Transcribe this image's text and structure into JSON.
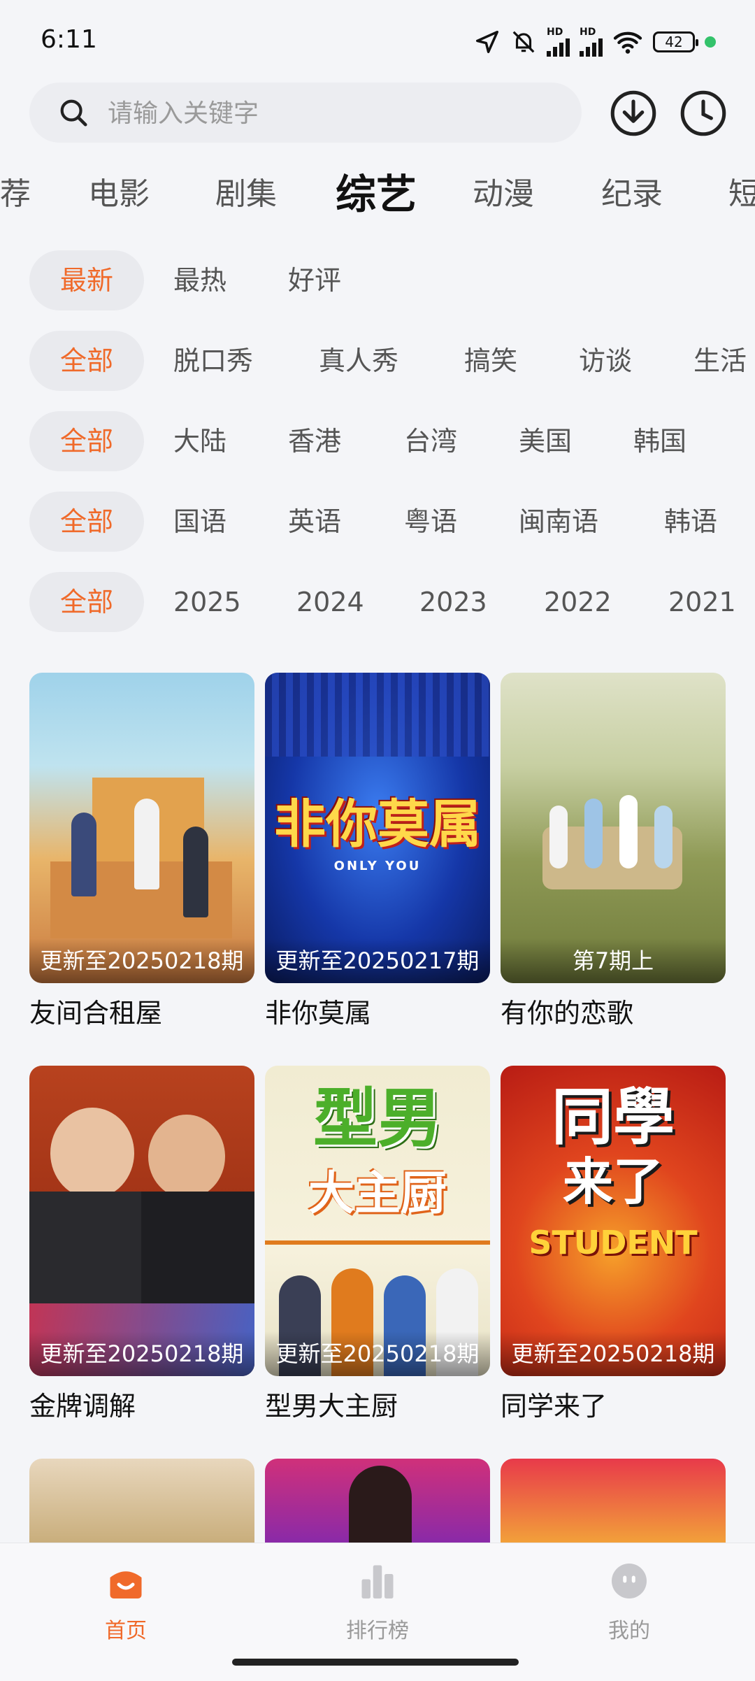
{
  "status_bar": {
    "time": "6:11",
    "battery": "42",
    "hd1": "HD",
    "hd2": "HD"
  },
  "search": {
    "placeholder": "请输入关键字"
  },
  "category_tabs": [
    "荐",
    "电影",
    "剧集",
    "综艺",
    "动漫",
    "纪录",
    "短"
  ],
  "active_tab": "综艺",
  "filters": {
    "sort": [
      "最新",
      "最热",
      "好评"
    ],
    "type": [
      "全部",
      "脱口秀",
      "真人秀",
      "搞笑",
      "访谈",
      "生活"
    ],
    "region": [
      "全部",
      "大陆",
      "香港",
      "台湾",
      "美国",
      "韩国"
    ],
    "language": [
      "全部",
      "国语",
      "英语",
      "粤语",
      "闽南语",
      "韩语"
    ],
    "year": [
      "全部",
      "2025",
      "2024",
      "2023",
      "2022",
      "2021"
    ]
  },
  "cards": [
    {
      "title": "友间合租屋",
      "badge": "更新至20250218期"
    },
    {
      "title": "非你莫属",
      "badge": "更新至20250217期",
      "poster_text": "非你莫属",
      "poster_sub": "ONLY YOU"
    },
    {
      "title": "有你的恋歌",
      "badge": "第7期上"
    },
    {
      "title": "金牌调解",
      "badge": "更新至20250218期"
    },
    {
      "title": "型男大主厨",
      "badge": "更新至20250218期",
      "poster_text1": "型男",
      "poster_text2": "大主厨"
    },
    {
      "title": "同学来了",
      "badge": "更新至20250218期",
      "poster_text1": "同學",
      "poster_text2": "来了",
      "poster_sub": "STUDENT"
    }
  ],
  "bottom_nav": [
    {
      "label": "首页",
      "icon": "home-icon"
    },
    {
      "label": "排行榜",
      "icon": "bar-chart-icon"
    },
    {
      "label": "我的",
      "icon": "profile-icon"
    }
  ],
  "colors": {
    "accent": "#f06a2a",
    "background": "#f4f5f8"
  }
}
